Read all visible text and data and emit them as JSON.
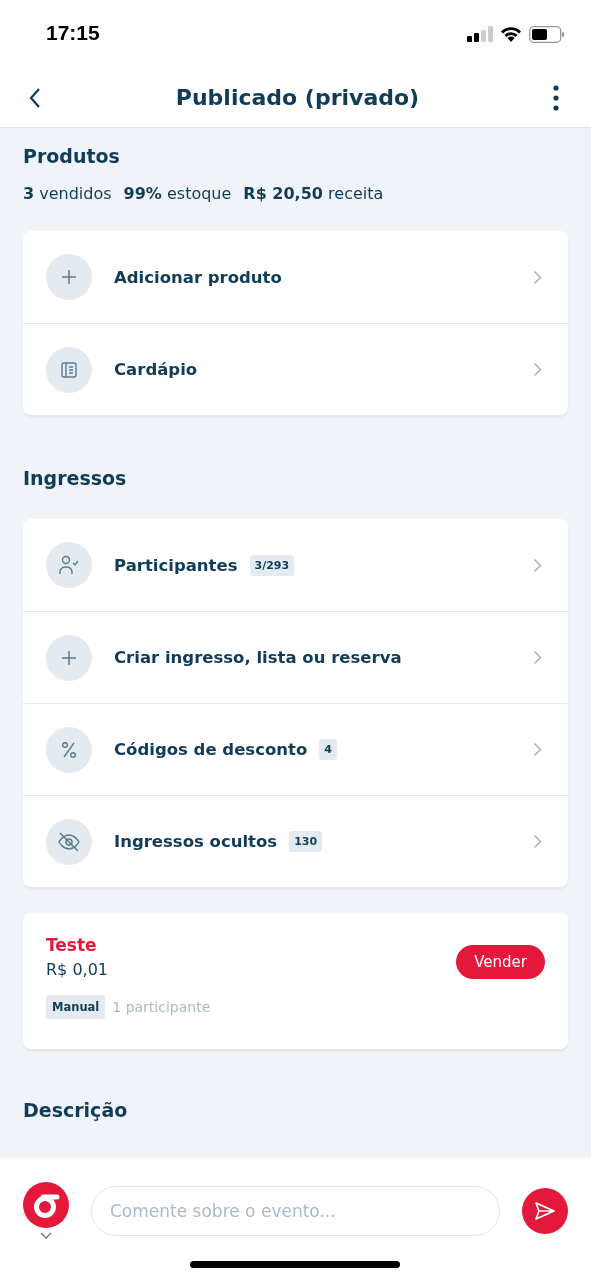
{
  "status_bar": {
    "time": "17:15"
  },
  "header": {
    "title": "Publicado (privado)"
  },
  "products": {
    "title": "Produtos",
    "stats": [
      "**3** vendidos",
      "**99%** estoque",
      "**R$ 20,50** receita"
    ],
    "items": [
      {
        "kind": "plus",
        "label": "Adicionar produto"
      },
      {
        "kind": "menu",
        "label": "Cardápio"
      }
    ]
  },
  "tickets": {
    "title": "Ingressos",
    "items": [
      {
        "kind": "person-check",
        "label": "Participantes",
        "badge": "3/293"
      },
      {
        "kind": "plus",
        "label": "Criar ingresso, lista ou reserva"
      },
      {
        "kind": "percent",
        "label": "Códigos de desconto",
        "badge": "4"
      },
      {
        "kind": "eye-off",
        "label": "Ingressos ocultos",
        "badge": "130"
      }
    ]
  },
  "ticket_card": {
    "name": "Teste",
    "price": "R$ 0,01",
    "button": "Vender",
    "tag": "Manual",
    "participants": "1 participante"
  },
  "description": {
    "title": "Descrição"
  },
  "comment_bar": {
    "placeholder": "Comente sobre o evento..."
  }
}
